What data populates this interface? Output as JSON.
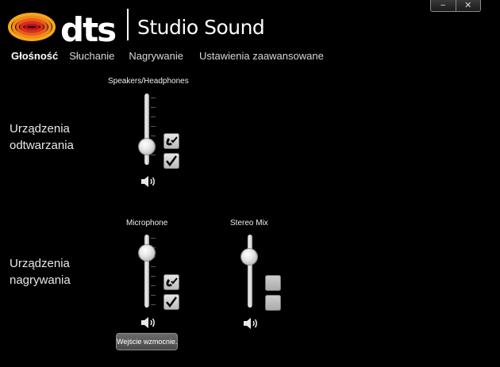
{
  "window": {
    "minimize_label": "−",
    "close_label": "✕"
  },
  "brand": {
    "logo_text": "dts",
    "product_name": "Studio Sound",
    "logo_colors": [
      "#f6a81b",
      "#f18a1a",
      "#e85d1b",
      "#d92e1b",
      "#b8121a"
    ]
  },
  "tabs": [
    {
      "label": "Głośność",
      "active": true
    },
    {
      "label": "Słuchanie",
      "active": false
    },
    {
      "label": "Nagrywanie",
      "active": false
    },
    {
      "label": "Ustawienia zaawansowane",
      "active": false
    }
  ],
  "playback": {
    "section_label_line1": "Urządzenia",
    "section_label_line2": "odtwarzania",
    "devices": [
      {
        "name": "Speakers/Headphones",
        "volume_level": 0.25,
        "default_comm_icon": "phone-check-icon",
        "default_checked": true,
        "speaker_icon": "speaker-icon"
      }
    ]
  },
  "recording": {
    "section_label_line1": "Urządzenia",
    "section_label_line2": "nagrywania",
    "devices": [
      {
        "name": "Microphone",
        "volume_level": 0.85,
        "default_comm_icon": "phone-check-icon",
        "default_checked": true,
        "speaker_icon": "speaker-icon"
      },
      {
        "name": "Stereo Mix",
        "volume_level": 0.75,
        "default_comm_checked": false,
        "default_checked": false,
        "speaker_icon": "speaker-icon"
      }
    ],
    "tooltip": "Wejście wzmocnie..."
  }
}
